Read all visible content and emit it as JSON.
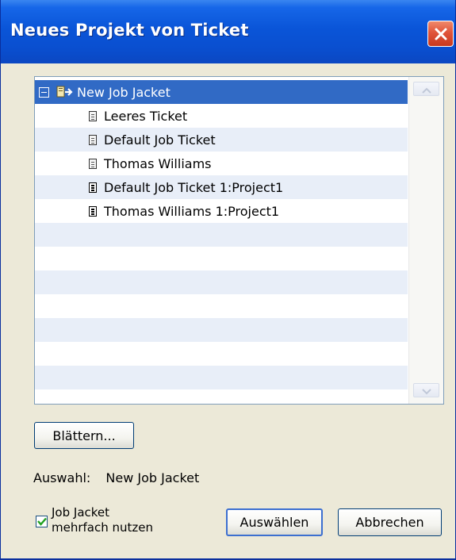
{
  "window": {
    "title": "Neues Projekt von Ticket"
  },
  "tree": {
    "root": {
      "label": "New Job Jacket",
      "expander": "minus",
      "icon": "job-jacket-icon",
      "selected": true
    },
    "children": [
      {
        "label": "Leeres Ticket",
        "icon": "ticket-template-icon"
      },
      {
        "label": "Default Job Ticket",
        "icon": "ticket-template-icon"
      },
      {
        "label": "Thomas Williams",
        "icon": "ticket-template-icon"
      },
      {
        "label": "Default Job Ticket 1:Project1",
        "icon": "ticket-instance-icon"
      },
      {
        "label": "Thomas Williams 1:Project1",
        "icon": "ticket-instance-icon"
      }
    ]
  },
  "buttons": {
    "browse": "Blättern...",
    "select": "Auswählen",
    "cancel": "Abbrechen"
  },
  "selection": {
    "label": "Auswahl:",
    "value": "New Job Jacket"
  },
  "reuse_checkbox": {
    "checked": true,
    "label_line1": "Job Jacket",
    "label_line2": "mehrfach nutzen"
  },
  "colors": {
    "titlebar": "#0a55d8",
    "selection_highlight": "#316ac5",
    "alt_row": "#e8eef8",
    "close_button": "#e0543a",
    "checkmark": "#21a121"
  }
}
